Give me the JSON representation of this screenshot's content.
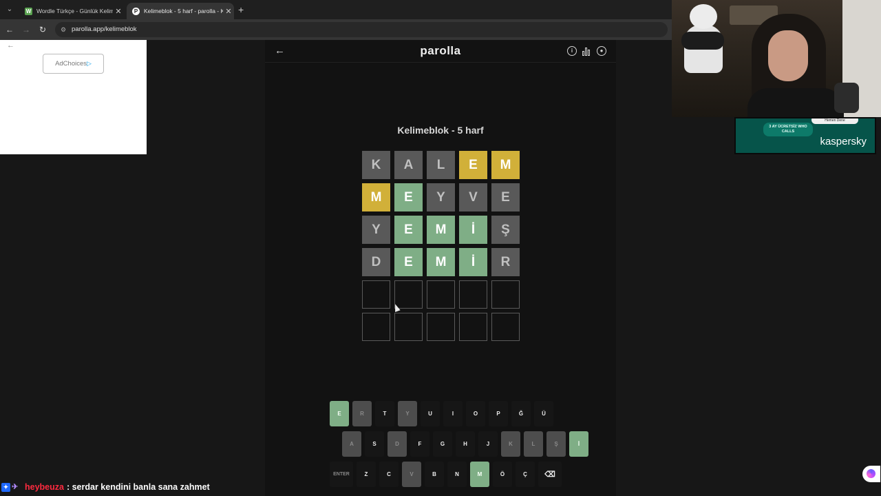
{
  "browser": {
    "tabs": [
      {
        "title": "Wordle Türkçe - Günlük Kelime",
        "favicon": "W"
      },
      {
        "title": "Kelimeblok - 5 harf - parolla - K",
        "favicon": "P"
      }
    ],
    "url": "parolla.app/kelimeblok"
  },
  "ads": {
    "adchoices": "AdChoices",
    "kaspersky_badge": "3 AY ÜCRETSİZ WHO CALLS",
    "kaspersky_button": "Hemen Dene",
    "kaspersky_logo": "kaspersky"
  },
  "game": {
    "logo": "parolla",
    "subtitle": "Kelimeblok - 5 harf",
    "board": [
      [
        {
          "l": "K",
          "s": "gray"
        },
        {
          "l": "A",
          "s": "gray"
        },
        {
          "l": "L",
          "s": "gray"
        },
        {
          "l": "E",
          "s": "yellow"
        },
        {
          "l": "M",
          "s": "yellow"
        }
      ],
      [
        {
          "l": "M",
          "s": "yellow"
        },
        {
          "l": "E",
          "s": "green"
        },
        {
          "l": "Y",
          "s": "gray"
        },
        {
          "l": "V",
          "s": "gray"
        },
        {
          "l": "E",
          "s": "gray"
        }
      ],
      [
        {
          "l": "Y",
          "s": "gray"
        },
        {
          "l": "E",
          "s": "green"
        },
        {
          "l": "M",
          "s": "green"
        },
        {
          "l": "İ",
          "s": "green"
        },
        {
          "l": "Ş",
          "s": "gray"
        }
      ],
      [
        {
          "l": "D",
          "s": "gray"
        },
        {
          "l": "E",
          "s": "green"
        },
        {
          "l": "M",
          "s": "green"
        },
        {
          "l": "İ",
          "s": "green"
        },
        {
          "l": "R",
          "s": "gray"
        }
      ],
      [
        {
          "l": "",
          "s": "empty"
        },
        {
          "l": "",
          "s": "empty"
        },
        {
          "l": "",
          "s": "empty"
        },
        {
          "l": "",
          "s": "empty"
        },
        {
          "l": "",
          "s": "empty"
        }
      ],
      [
        {
          "l": "",
          "s": "empty"
        },
        {
          "l": "",
          "s": "empty"
        },
        {
          "l": "",
          "s": "empty"
        },
        {
          "l": "",
          "s": "empty"
        },
        {
          "l": "",
          "s": "empty"
        }
      ]
    ],
    "keyboard": [
      [
        {
          "k": "E",
          "s": "green"
        },
        {
          "k": "R",
          "s": "gray"
        },
        {
          "k": "T",
          "s": ""
        },
        {
          "k": "Y",
          "s": "gray"
        },
        {
          "k": "U",
          "s": ""
        },
        {
          "k": "I",
          "s": ""
        },
        {
          "k": "O",
          "s": ""
        },
        {
          "k": "P",
          "s": ""
        },
        {
          "k": "Ğ",
          "s": ""
        },
        {
          "k": "Ü",
          "s": ""
        }
      ],
      [
        {
          "k": "A",
          "s": "gray"
        },
        {
          "k": "S",
          "s": ""
        },
        {
          "k": "D",
          "s": "gray"
        },
        {
          "k": "F",
          "s": ""
        },
        {
          "k": "G",
          "s": ""
        },
        {
          "k": "H",
          "s": ""
        },
        {
          "k": "J",
          "s": ""
        },
        {
          "k": "K",
          "s": "gray"
        },
        {
          "k": "L",
          "s": "gray"
        },
        {
          "k": "Ş",
          "s": "gray"
        },
        {
          "k": "İ",
          "s": "green"
        }
      ],
      [
        {
          "k": "ENTER",
          "s": "wide"
        },
        {
          "k": "Z",
          "s": ""
        },
        {
          "k": "C",
          "s": ""
        },
        {
          "k": "V",
          "s": "gray"
        },
        {
          "k": "B",
          "s": ""
        },
        {
          "k": "N",
          "s": ""
        },
        {
          "k": "M",
          "s": "green"
        },
        {
          "k": "Ö",
          "s": ""
        },
        {
          "k": "Ç",
          "s": ""
        },
        {
          "k": "⌫",
          "s": "back"
        }
      ]
    ]
  },
  "chat": {
    "user": "heybeuza",
    "message": ": serdar kendini banla sana zahmet"
  }
}
